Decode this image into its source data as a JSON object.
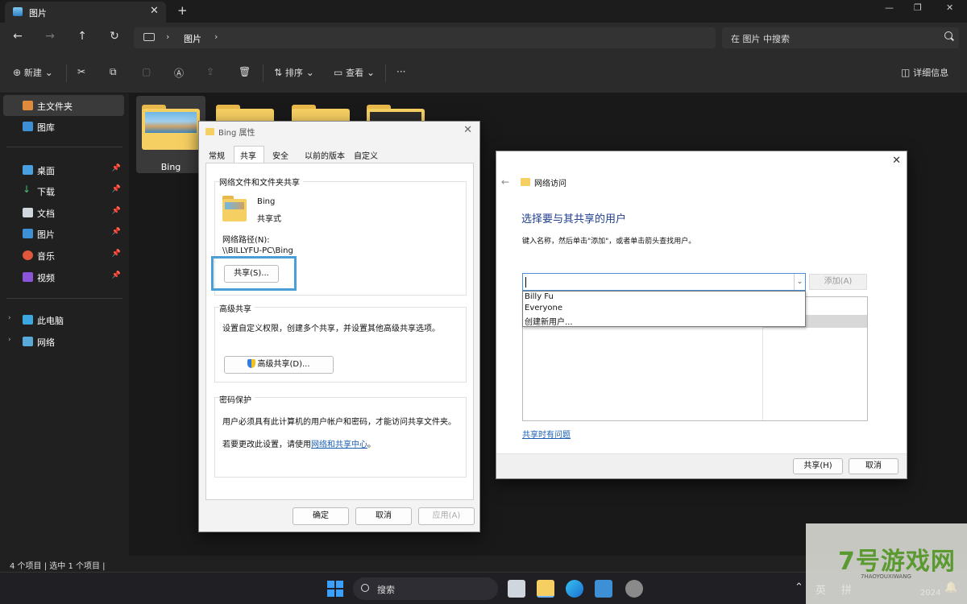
{
  "window": {
    "tab_title": "图片",
    "tab_close": "✕",
    "new_tab": "+",
    "minimize": "—",
    "maximize": "❐",
    "close": "✕"
  },
  "address": {
    "breadcrumb": "图片",
    "search_placeholder": "在 图片 中搜索"
  },
  "toolbar": {
    "new_label": "新建",
    "sort_label": "排序",
    "view_label": "查看",
    "more_label": "···",
    "details_label": "详细信息"
  },
  "sidebar": {
    "items": [
      {
        "label": "主文件夹",
        "icon": "home-icon"
      },
      {
        "label": "图库",
        "icon": "gallery-icon"
      },
      {
        "label": "桌面",
        "icon": "desktop-icon"
      },
      {
        "label": "下载",
        "icon": "download-icon"
      },
      {
        "label": "文档",
        "icon": "document-icon"
      },
      {
        "label": "图片",
        "icon": "picture-icon"
      },
      {
        "label": "音乐",
        "icon": "music-icon"
      },
      {
        "label": "视频",
        "icon": "video-icon"
      },
      {
        "label": "此电脑",
        "icon": "computer-icon"
      },
      {
        "label": "网络",
        "icon": "network-icon"
      }
    ]
  },
  "content": {
    "folders": [
      {
        "label": "Bing"
      }
    ]
  },
  "status": {
    "text": "4 个项目  |  选中 1 个项目  |"
  },
  "taskbar": {
    "search_label": "搜索",
    "ime_lang": "英",
    "ime_mode": "拼",
    "year": "2024"
  },
  "watermark": {
    "brand": "7号游戏网",
    "sub": "7HAOYOUXIWANG"
  },
  "props_dialog": {
    "title": "Bing 属性",
    "tabs": [
      "常规",
      "共享",
      "安全",
      "以前的版本",
      "自定义"
    ],
    "share_group_title": "网络文件和文件夹共享",
    "folder_name": "Bing",
    "folder_state": "共享式",
    "path_label": "网络路径(N):",
    "path_value": "\\\\BILLYFU-PC\\Bing",
    "share_button": "共享(S)...",
    "adv_group_title": "高级共享",
    "adv_desc": "设置自定义权限，创建多个共享，并设置其他高级共享选项。",
    "adv_button": "高级共享(D)...",
    "pwd_group_title": "密码保护",
    "pwd_desc": "用户必须具有此计算机的用户帐户和密码，才能访问共享文件夹。",
    "pwd_change_prefix": "若要更改此设置，请使用",
    "pwd_link": "网络和共享中心",
    "pwd_change_suffix": "。",
    "ok": "确定",
    "cancel": "取消",
    "apply": "应用(A)"
  },
  "net_dialog": {
    "title": "网络访问",
    "heading": "选择要与其共享的用户",
    "desc": "键入名称，然后单击\"添加\"，或者单击箭头查找用户。",
    "input_value": "",
    "add_button": "添加(A)",
    "dropdown_options": [
      "Billy Fu",
      "Everyone",
      "创建新用户..."
    ],
    "help_link": "共享时有问题",
    "share_button": "共享(H)",
    "cancel_button": "取消"
  }
}
